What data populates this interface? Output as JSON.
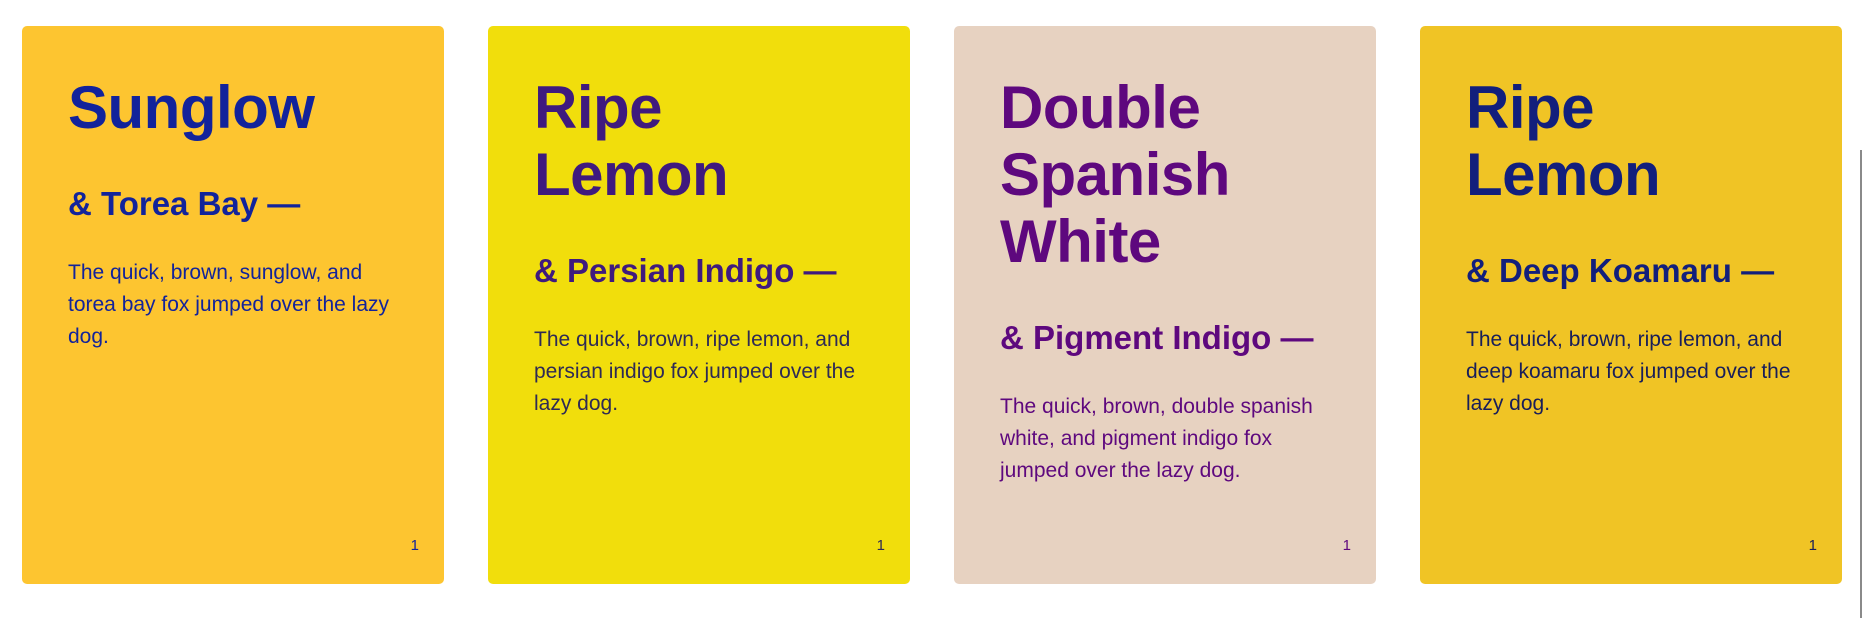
{
  "cards": [
    {
      "title": "Sunglow",
      "subtitle": "& Torea Bay —",
      "body": "The quick, brown, sunglow, and torea bay fox jumped over the lazy dog.",
      "page": "1",
      "background": "#FDC530",
      "heading_color": "#12239B",
      "text_color": "#12239B"
    },
    {
      "title": "Ripe Lemon",
      "subtitle": "& Persian Indigo —",
      "body": "The quick, brown, ripe lemon, and persian indigo fox jumped over the lazy dog.",
      "page": "1",
      "background": "#F1DE0C",
      "heading_color": "#3F1A7E",
      "text_color": "#2E2A55"
    },
    {
      "title": "Double Spanish White",
      "subtitle": "& Pigment Indigo —",
      "body": "The quick, brown, double spanish white, and pigment indigo fox jumped over the lazy dog.",
      "page": "1",
      "background": "#E7D2C1",
      "heading_color": "#5E087E",
      "text_color": "#5E087E"
    },
    {
      "title": "Ripe Lemon",
      "subtitle": "& Deep Koamaru —",
      "body": "The quick, brown, ripe lemon, and deep koamaru fox jumped over the lazy dog.",
      "page": "1",
      "background": "#F0C425",
      "heading_color": "#121F7C",
      "text_color": "#181E5A"
    }
  ]
}
